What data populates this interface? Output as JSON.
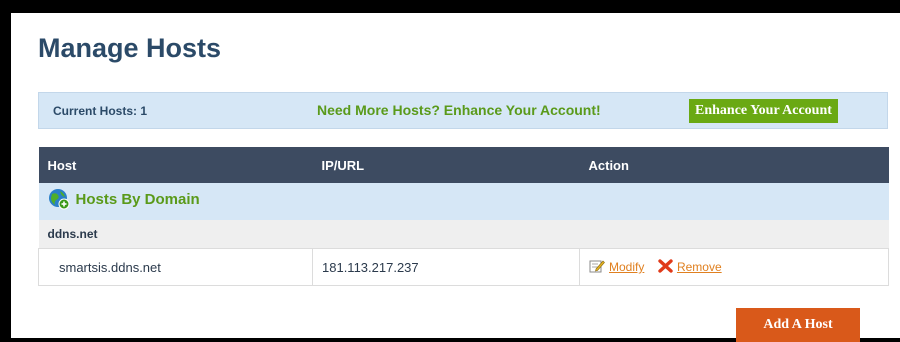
{
  "page": {
    "title": "Manage Hosts"
  },
  "info_bar": {
    "current_hosts": "Current Hosts: 1",
    "need_more": "Need More Hosts? Enhance Your Account!",
    "enhance_button": "Enhance Your Account"
  },
  "table": {
    "headers": [
      "Host",
      "IP/URL",
      "Action"
    ],
    "group_label": "Hosts By Domain",
    "group_icon": "globe-add-icon",
    "domain": "ddns.net",
    "rows": [
      {
        "host": "smartsis.ddns.net",
        "ip": "181.113.217.237",
        "modify_label": "Modify",
        "remove_label": "Remove"
      }
    ]
  },
  "add_host_button": "Add A Host",
  "colors": {
    "title": "#2b4a68",
    "header_bg": "#3d4b61",
    "info_bg": "#d6e7f6",
    "accent_green": "#6aa913",
    "link_orange": "#e08020",
    "button_orange": "#d9591a"
  }
}
